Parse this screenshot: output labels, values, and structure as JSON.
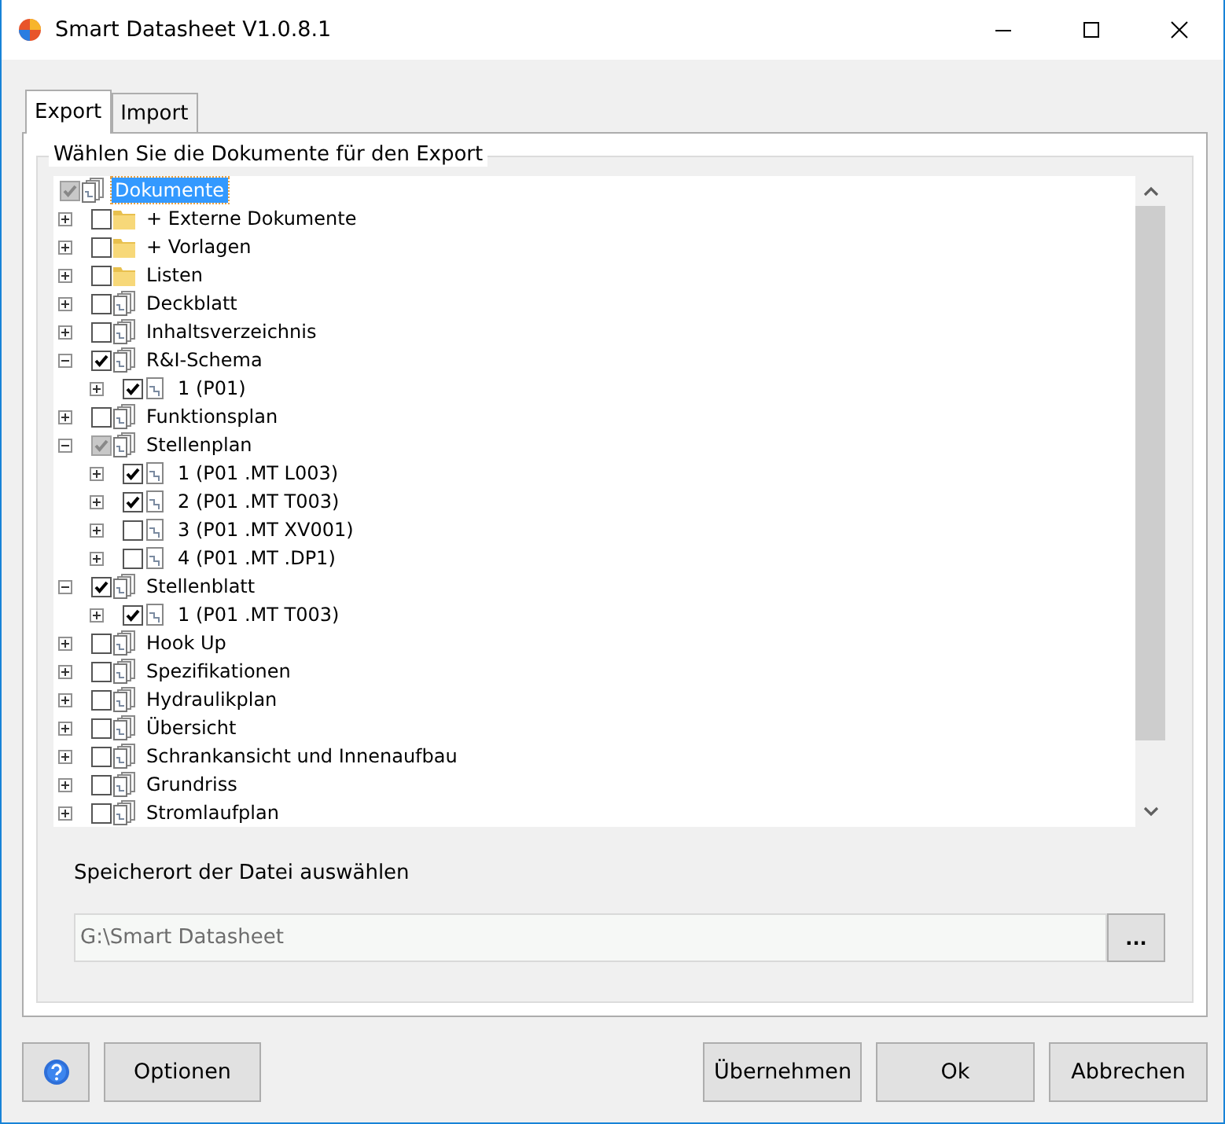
{
  "window": {
    "title": "Smart Datasheet V1.0.8.1"
  },
  "tabs": [
    {
      "label": "Export",
      "selected": true
    },
    {
      "label": "Import",
      "selected": false
    }
  ],
  "group": {
    "title": "Wählen Sie die Dokumente für den Export"
  },
  "tree": [
    {
      "label": "Dokumente",
      "kind": "doc-stack",
      "checked": true,
      "partial": true,
      "selected": true,
      "children": [
        {
          "label": "+ Externe Dokumente",
          "kind": "folder",
          "checked": false,
          "partial": false,
          "selected": false,
          "expanded": false
        },
        {
          "label": "+ Vorlagen",
          "kind": "folder",
          "checked": false,
          "partial": false,
          "selected": false,
          "expanded": false
        },
        {
          "label": "Listen",
          "kind": "folder",
          "checked": false,
          "partial": false,
          "selected": false,
          "expanded": false
        },
        {
          "label": "Deckblatt",
          "kind": "doc-stack",
          "checked": false,
          "partial": false,
          "selected": false,
          "expanded": false
        },
        {
          "label": "Inhaltsverzeichnis",
          "kind": "doc-stack",
          "checked": false,
          "partial": false,
          "selected": false,
          "expanded": false
        },
        {
          "label": "R&I-Schema",
          "kind": "doc-stack",
          "checked": true,
          "partial": false,
          "selected": false,
          "expanded": true,
          "children": [
            {
              "label": "1  (P01)",
              "kind": "doc",
              "checked": true,
              "partial": false,
              "selected": false,
              "expanded": false
            }
          ]
        },
        {
          "label": "Funktionsplan",
          "kind": "doc-stack",
          "checked": false,
          "partial": false,
          "selected": false,
          "expanded": false
        },
        {
          "label": "Stellenplan",
          "kind": "doc-stack",
          "checked": true,
          "partial": true,
          "selected": false,
          "expanded": true,
          "children": [
            {
              "label": "1  (P01 .MT L003)",
              "kind": "doc",
              "checked": true,
              "partial": false,
              "selected": false,
              "expanded": false
            },
            {
              "label": "2  (P01 .MT T003)",
              "kind": "doc",
              "checked": true,
              "partial": false,
              "selected": false,
              "expanded": false
            },
            {
              "label": "3  (P01 .MT XV001)",
              "kind": "doc",
              "checked": false,
              "partial": false,
              "selected": false,
              "expanded": false
            },
            {
              "label": "4  (P01 .MT .DP1)",
              "kind": "doc",
              "checked": false,
              "partial": false,
              "selected": false,
              "expanded": false
            }
          ]
        },
        {
          "label": "Stellenblatt",
          "kind": "doc-stack",
          "checked": true,
          "partial": false,
          "selected": false,
          "expanded": true,
          "children": [
            {
              "label": "1  (P01 .MT T003)",
              "kind": "doc",
              "checked": true,
              "partial": false,
              "selected": false,
              "expanded": false
            }
          ]
        },
        {
          "label": "Hook Up",
          "kind": "doc-stack",
          "checked": false,
          "partial": false,
          "selected": false,
          "expanded": false
        },
        {
          "label": "Spezifikationen",
          "kind": "doc-stack",
          "checked": false,
          "partial": false,
          "selected": false,
          "expanded": false
        },
        {
          "label": "Hydraulikplan",
          "kind": "doc-stack",
          "checked": false,
          "partial": false,
          "selected": false,
          "expanded": false
        },
        {
          "label": "Übersicht",
          "kind": "doc-stack",
          "checked": false,
          "partial": false,
          "selected": false,
          "expanded": false
        },
        {
          "label": "Schrankansicht und Innenaufbau",
          "kind": "doc-stack",
          "checked": false,
          "partial": false,
          "selected": false,
          "expanded": false
        },
        {
          "label": "Grundriss",
          "kind": "doc-stack",
          "checked": false,
          "partial": false,
          "selected": false,
          "expanded": false
        },
        {
          "label": "Stromlaufplan",
          "kind": "doc-stack",
          "checked": false,
          "partial": false,
          "selected": false,
          "expanded": false
        }
      ]
    }
  ],
  "save": {
    "label": "Speicherort der Datei auswählen",
    "value": "G:\\Smart Datasheet",
    "browse": "..."
  },
  "buttons": [
    {
      "label": "Optionen"
    },
    {
      "label": "Übernehmen"
    },
    {
      "label": "Ok"
    },
    {
      "label": "Abbrechen"
    }
  ]
}
